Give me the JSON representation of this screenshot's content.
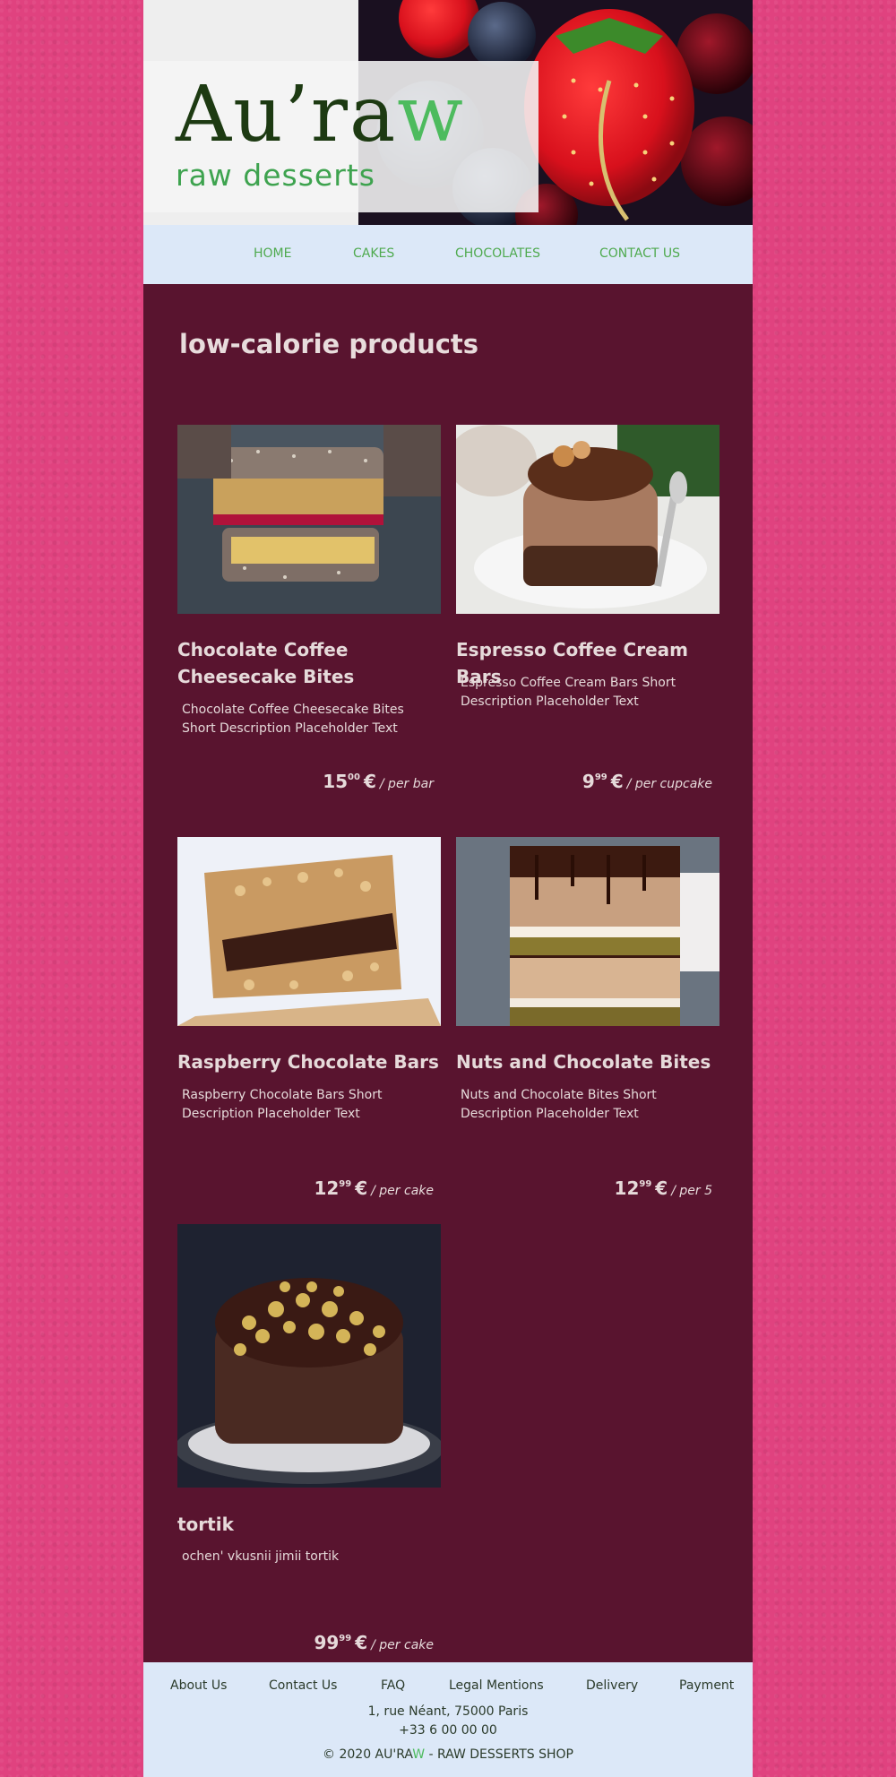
{
  "header": {
    "logo_main_prefix": "Au’ra",
    "logo_main_accent": "w",
    "logo_sub": "raw desserts"
  },
  "nav": {
    "items": [
      {
        "label": "HOME"
      },
      {
        "label": "CAKES"
      },
      {
        "label": "CHOCOLATES"
      },
      {
        "label": "CONTACT US"
      }
    ]
  },
  "main": {
    "title": "low-calorie products",
    "products": [
      {
        "name": "Chocolate Coffee Cheesecake Bites",
        "description": "Chocolate Coffee Cheesecake Bites Short Description Placeholder Text",
        "price_int": "15",
        "price_dec": "00",
        "currency": "€",
        "unit": "/ per bar"
      },
      {
        "name": "Espresso Coffee Cream Bars",
        "description": "Espresso Coffee Cream Bars Short Description Placeholder Text",
        "price_int": "9",
        "price_dec": "99",
        "currency": "€",
        "unit": "/ per cupcake"
      },
      {
        "name": "Raspberry Chocolate Bars",
        "description": "Raspberry Chocolate Bars Short Description Placeholder Text",
        "price_int": "12",
        "price_dec": "99",
        "currency": "€",
        "unit": "/ per cake"
      },
      {
        "name": "Nuts and Chocolate Bites",
        "description": "Nuts and Chocolate Bites Short Description Placeholder Text",
        "price_int": "12",
        "price_dec": "99",
        "currency": "€",
        "unit": "/ per 5"
      },
      {
        "name": "tortik",
        "description": "ochen' vkusnii jimii tortik",
        "price_int": "99",
        "price_dec": "99",
        "currency": "€",
        "unit": "/ per cake"
      }
    ]
  },
  "footer": {
    "links": [
      {
        "label": "About Us"
      },
      {
        "label": "Contact Us"
      },
      {
        "label": "FAQ"
      },
      {
        "label": "Legal Mentions"
      },
      {
        "label": "Delivery"
      },
      {
        "label": "Payment"
      }
    ],
    "address_line1": "1, rue Néant, 75000 Paris",
    "address_line2": "+33 6 00 00 00",
    "copyright_prefix": "© 2020 AU'RA",
    "copyright_accent": "W",
    "copyright_suffix": " - RAW DESSERTS SHOP"
  },
  "colors": {
    "page_bg": "#e0427f",
    "content_bg": "#59142f",
    "nav_bg": "#dce8f8",
    "nav_link": "#4faa4f",
    "logo_dark": "#1d3a12",
    "logo_green": "#4dbb5e"
  }
}
